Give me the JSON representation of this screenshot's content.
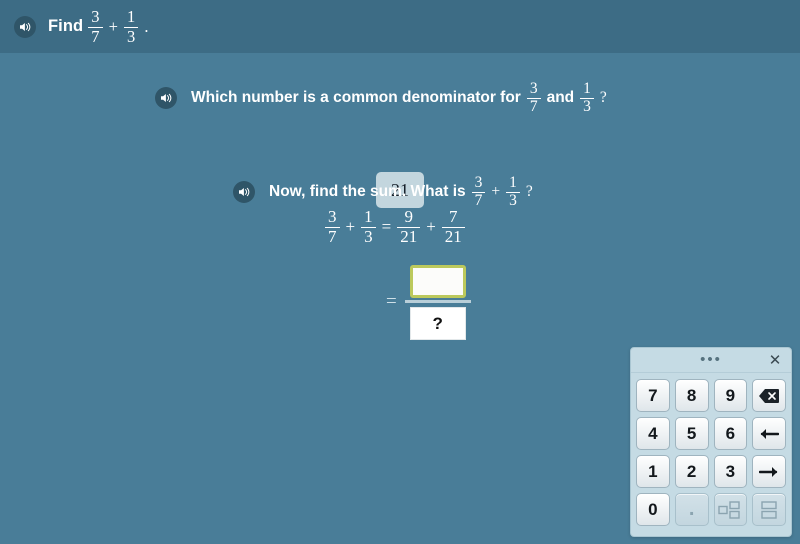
{
  "header": {
    "speaker_icon": "speaker-icon",
    "label": "Find",
    "fraction1": {
      "numerator": "3",
      "denominator": "7"
    },
    "operator": "+",
    "fraction2": {
      "numerator": "1",
      "denominator": "3"
    },
    "period": "."
  },
  "question1": {
    "speaker_icon": "speaker-icon",
    "text_before": "Which number is a common denominator for",
    "fraction1": {
      "numerator": "3",
      "denominator": "7"
    },
    "conjunction": "and",
    "fraction2": {
      "numerator": "1",
      "denominator": "3"
    },
    "question_mark": "?",
    "answer_value": "21"
  },
  "question2": {
    "speaker_icon": "speaker-icon",
    "text_before": "Now, find the sum. What is",
    "fraction1": {
      "numerator": "3",
      "denominator": "7"
    },
    "operator": "+",
    "fraction2": {
      "numerator": "1",
      "denominator": "3"
    },
    "question_mark": "?"
  },
  "equation": {
    "left_frac1": {
      "numerator": "3",
      "denominator": "7"
    },
    "plus1": "+",
    "left_frac2": {
      "numerator": "1",
      "denominator": "3"
    },
    "equals": "=",
    "right_frac1": {
      "numerator": "9",
      "denominator": "21"
    },
    "plus2": "+",
    "right_frac2": {
      "numerator": "7",
      "denominator": "21"
    }
  },
  "answer_input": {
    "equals": "=",
    "numerator_value": "",
    "numerator_placeholder": "",
    "denominator_value": "?"
  },
  "keypad": {
    "drag_dots": "•••",
    "close_label": "✕",
    "keys": [
      {
        "label": "7",
        "name": "key-7",
        "type": "digit",
        "disabled": false
      },
      {
        "label": "8",
        "name": "key-8",
        "type": "digit",
        "disabled": false
      },
      {
        "label": "9",
        "name": "key-9",
        "type": "digit",
        "disabled": false
      },
      {
        "label": "",
        "name": "backspace-key",
        "type": "backspace",
        "disabled": false
      },
      {
        "label": "4",
        "name": "key-4",
        "type": "digit",
        "disabled": false
      },
      {
        "label": "5",
        "name": "key-5",
        "type": "digit",
        "disabled": false
      },
      {
        "label": "6",
        "name": "key-6",
        "type": "digit",
        "disabled": false
      },
      {
        "label": "",
        "name": "arrow-left-key",
        "type": "arrow-left",
        "disabled": false
      },
      {
        "label": "1",
        "name": "key-1",
        "type": "digit",
        "disabled": false
      },
      {
        "label": "2",
        "name": "key-2",
        "type": "digit",
        "disabled": false
      },
      {
        "label": "3",
        "name": "key-3",
        "type": "digit",
        "disabled": false
      },
      {
        "label": "",
        "name": "arrow-right-key",
        "type": "arrow-right",
        "disabled": false
      },
      {
        "label": "0",
        "name": "key-0",
        "type": "digit",
        "disabled": false
      },
      {
        "label": ".",
        "name": "key-decimal",
        "type": "dot",
        "disabled": true
      },
      {
        "label": "",
        "name": "mixed-number-key",
        "type": "mixed",
        "disabled": true
      },
      {
        "label": "",
        "name": "fraction-key",
        "type": "fraction",
        "disabled": true
      }
    ]
  },
  "colors": {
    "header_bg": "#3d6c85",
    "body_bg": "#497d98",
    "answer_chip_bg": "#c3d6de",
    "active_input_border": "#bcc95c",
    "keypad_bg": "#c5dbe4"
  }
}
